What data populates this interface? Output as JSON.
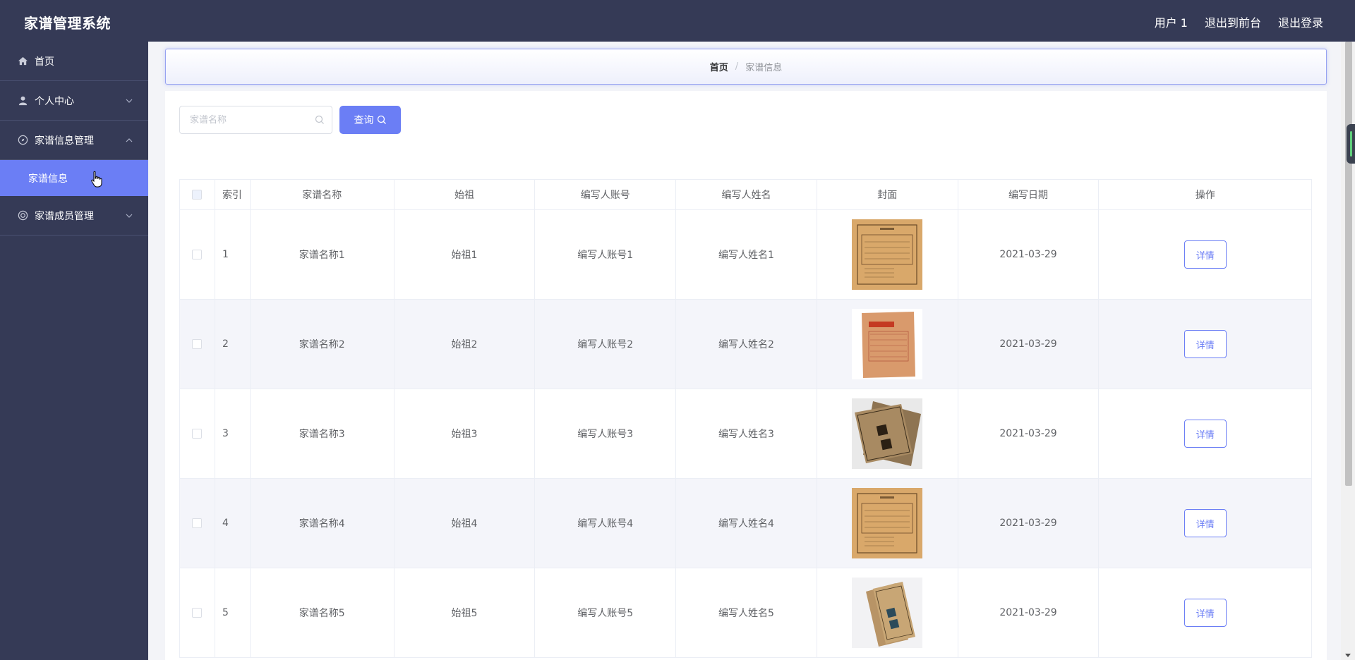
{
  "app": {
    "title": "家谱管理系统",
    "user_label": "用户 1",
    "back_to_front": "退出到前台",
    "logout": "退出登录"
  },
  "sidebar": {
    "items": [
      {
        "label": "首页",
        "icon": "home-icon"
      },
      {
        "label": "个人中心",
        "icon": "user-icon"
      },
      {
        "label": "家谱信息管理",
        "icon": "compass-icon"
      },
      {
        "label": "家谱成员管理",
        "icon": "circle-icon"
      }
    ],
    "submenu": {
      "label": "家谱信息"
    }
  },
  "breadcrumb": {
    "home": "首页",
    "separator": "/",
    "current": "家谱信息"
  },
  "search": {
    "placeholder": "家谱名称",
    "button_label": "查询"
  },
  "table": {
    "headers": {
      "index": "索引",
      "name": "家谱名称",
      "ancestor": "始祖",
      "writer_account": "编写人账号",
      "writer_name": "编写人姓名",
      "cover": "封面",
      "date": "编写日期",
      "operation": "操作"
    },
    "rows": [
      {
        "index": "1",
        "name": "家谱名称1",
        "ancestor": "始祖1",
        "writer_account": "编写人账号1",
        "writer_name": "编写人姓名1",
        "date": "2021-03-29",
        "action": "详情"
      },
      {
        "index": "2",
        "name": "家谱名称2",
        "ancestor": "始祖2",
        "writer_account": "编写人账号2",
        "writer_name": "编写人姓名2",
        "date": "2021-03-29",
        "action": "详情"
      },
      {
        "index": "3",
        "name": "家谱名称3",
        "ancestor": "始祖3",
        "writer_account": "编写人账号3",
        "writer_name": "编写人姓名3",
        "date": "2021-03-29",
        "action": "详情"
      },
      {
        "index": "4",
        "name": "家谱名称4",
        "ancestor": "始祖4",
        "writer_account": "编写人账号4",
        "writer_name": "编写人姓名4",
        "date": "2021-03-29",
        "action": "详情"
      },
      {
        "index": "5",
        "name": "家谱名称5",
        "ancestor": "始祖5",
        "writer_account": "编写人账号5",
        "writer_name": "编写人姓名5",
        "date": "2021-03-29",
        "action": "详情"
      }
    ]
  },
  "colors": {
    "sidebar_bg": "#353a56",
    "accent": "#6b7ef5"
  }
}
